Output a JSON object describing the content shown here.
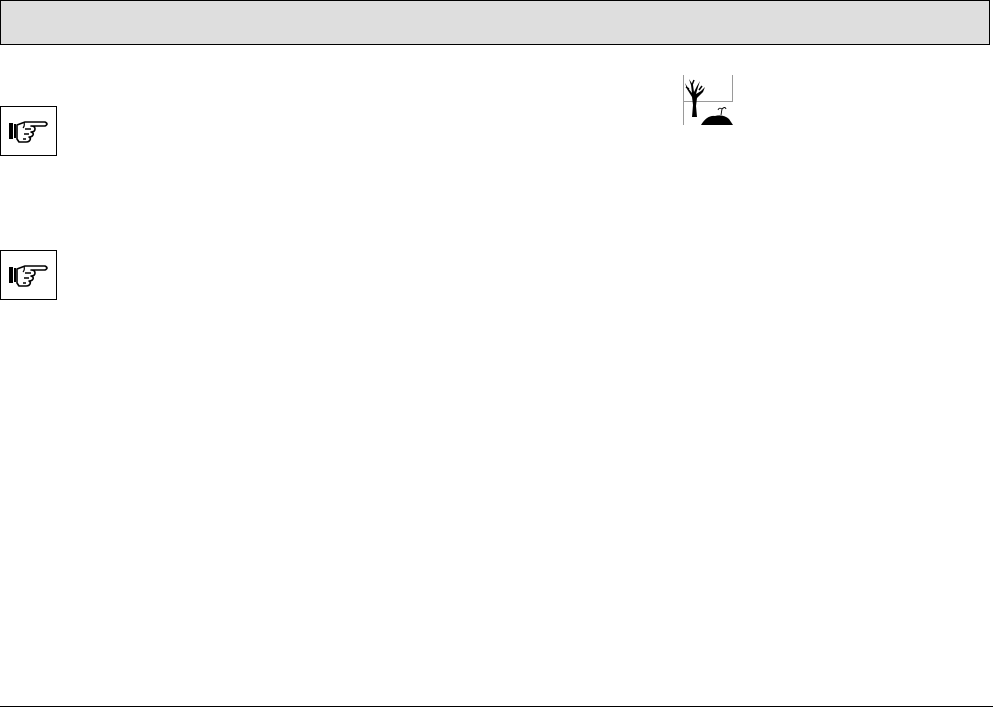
{
  "header": {
    "background": "#dedede"
  },
  "notes": [
    {
      "icon": "pointing-hand-icon"
    },
    {
      "icon": "pointing-hand-icon"
    }
  ],
  "figure": {
    "icon": "dead-tree-icon"
  }
}
